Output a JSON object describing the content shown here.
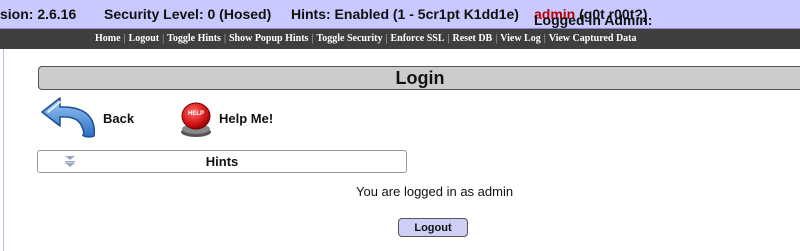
{
  "status_bar": {
    "version": "sion: 2.6.16",
    "security": "Security Level: 0 (Hosed)",
    "hints": "Hints: Enabled (1 - 5cr1pt K1dd1e)",
    "admin_prefix": "Logged In Admin: ",
    "admin_name": "admin",
    "admin_suffix": " (g0t r00t?)"
  },
  "nav": {
    "items": [
      "Home",
      "Logout",
      "Toggle Hints",
      "Show Popup Hints",
      "Toggle Security",
      "Enforce SSL",
      "Reset DB",
      "View Log",
      "View Captured Data"
    ],
    "separator": "|"
  },
  "page": {
    "title": "Login",
    "back_label": "Back",
    "help_label": "Help Me!",
    "help_icon_text": "HELP",
    "hints_label": "Hints",
    "logged_in_message": "You are logged in as admin",
    "logout_button": "Logout"
  },
  "colors": {
    "status_bg": "#c9c9ff",
    "nav_bg": "#3f3f3f",
    "admin_name": "#b30000",
    "logout_bg": "#cfcff5"
  },
  "icons": {
    "back": "back-arrow-icon",
    "help": "help-button-icon",
    "hints": "double-chevron-down-icon"
  }
}
